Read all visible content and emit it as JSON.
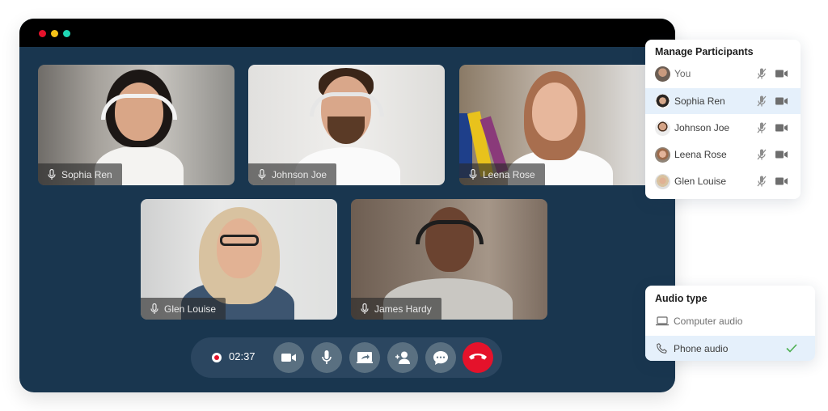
{
  "window": {
    "controls": [
      {
        "name": "close",
        "color": "#e5122b"
      },
      {
        "name": "minimize",
        "color": "#f5c218"
      },
      {
        "name": "maximize",
        "color": "#1fd6b4"
      }
    ]
  },
  "tiles": [
    {
      "name": "Sophia Ren",
      "mic_icon": "microphone-icon"
    },
    {
      "name": "Johnson Joe",
      "mic_icon": "microphone-icon"
    },
    {
      "name": "Leena Rose",
      "mic_icon": "microphone-icon"
    },
    {
      "name": "Glen Louise",
      "mic_icon": "microphone-icon"
    },
    {
      "name": "James Hardy",
      "mic_icon": "microphone-icon"
    }
  ],
  "call_controls": {
    "recording_indicator": "record-icon",
    "timer": "02:37",
    "buttons": [
      {
        "name": "video",
        "icon": "video-camera-icon"
      },
      {
        "name": "mic",
        "icon": "microphone-icon"
      },
      {
        "name": "share-screen",
        "icon": "share-screen-icon"
      },
      {
        "name": "add-participant",
        "icon": "add-user-icon"
      },
      {
        "name": "chat",
        "icon": "chat-bubble-icon"
      },
      {
        "name": "end-call",
        "icon": "phone-hangup-icon",
        "color": "#e5122b"
      }
    ]
  },
  "participants_panel": {
    "title": "Manage Participants",
    "participants": [
      {
        "name": "You",
        "muted": true,
        "camera": true,
        "active": false
      },
      {
        "name": "Sophia Ren",
        "muted": true,
        "camera": true,
        "active": true
      },
      {
        "name": "Johnson Joe",
        "muted": true,
        "camera": true,
        "active": false
      },
      {
        "name": "Leena Rose",
        "muted": true,
        "camera": true,
        "active": false
      },
      {
        "name": "Glen Louise",
        "muted": true,
        "camera": true,
        "active": false
      }
    ]
  },
  "audio_panel": {
    "title": "Audio type",
    "options": [
      {
        "label": "Computer audio",
        "icon": "laptop-icon",
        "selected": false
      },
      {
        "label": "Phone audio",
        "icon": "phone-icon",
        "selected": true
      }
    ],
    "check_color": "#4caf50"
  }
}
